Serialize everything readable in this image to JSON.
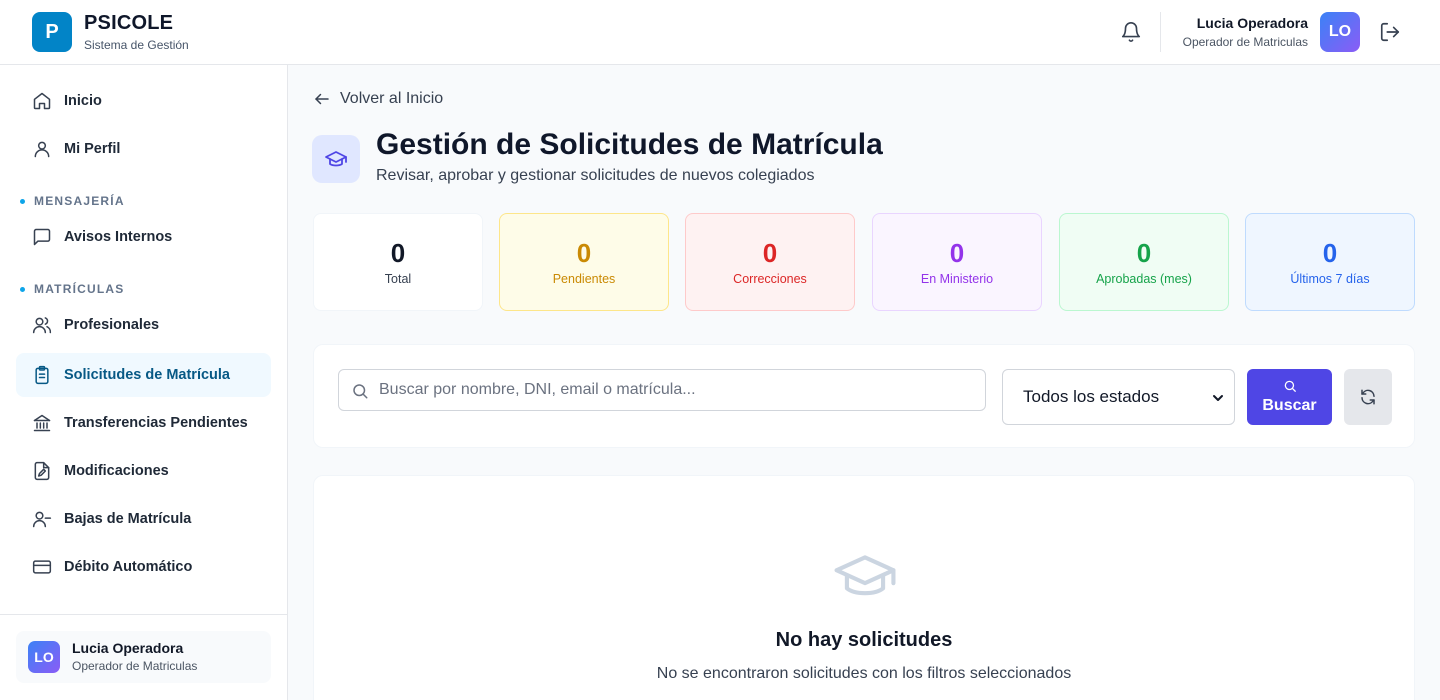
{
  "header": {
    "logo_letter": "P",
    "brand": "PSICOLE",
    "brand_sub": "Sistema de Gestión",
    "user_name": "Lucia Operadora",
    "user_role": "Operador de Matriculas",
    "avatar_initials": "LO"
  },
  "sidebar": {
    "items": [
      {
        "label": "Inicio",
        "icon": "home-icon"
      },
      {
        "label": "Mi Perfil",
        "icon": "user-icon"
      },
      {
        "label": "Avisos Internos",
        "icon": "message-icon"
      },
      {
        "label": "Profesionales",
        "icon": "users-icon"
      },
      {
        "label": "Solicitudes de Matrícula",
        "icon": "clipboard-icon",
        "active": true
      },
      {
        "label": "Transferencias Pendientes",
        "icon": "bank-icon"
      },
      {
        "label": "Modificaciones",
        "icon": "file-edit-icon"
      },
      {
        "label": "Bajas de Matrícula",
        "icon": "user-minus-icon"
      },
      {
        "label": "Débito Automático",
        "icon": "credit-card-icon"
      }
    ],
    "sections": [
      "MENSAJERÍA",
      "MATRÍCULAS"
    ],
    "footer": {
      "initials": "LO",
      "name": "Lucia Operadora",
      "role": "Operador de Matriculas"
    }
  },
  "main": {
    "back_label": "Volver al Inicio",
    "title": "Gestión de Solicitudes de Matrícula",
    "subtitle": "Revisar, aprobar y gestionar solicitudes de nuevos colegiados",
    "stats": [
      {
        "value": "0",
        "label": "Total",
        "color": "#111827",
        "bg": "#ffffff",
        "border": "#f1f5f9"
      },
      {
        "value": "0",
        "label": "Pendientes",
        "color": "#ca8a04",
        "bg": "#fefce8",
        "border": "#fde68a"
      },
      {
        "value": "0",
        "label": "Correcciones",
        "color": "#dc2626",
        "bg": "#fef2f2",
        "border": "#fecaca"
      },
      {
        "value": "0",
        "label": "En Ministerio",
        "color": "#9333ea",
        "bg": "#faf5ff",
        "border": "#e9d5ff"
      },
      {
        "value": "0",
        "label": "Aprobadas (mes)",
        "color": "#16a34a",
        "bg": "#f0fdf4",
        "border": "#bbf7d0"
      },
      {
        "value": "0",
        "label": "Últimos 7 días",
        "color": "#2563eb",
        "bg": "#eff6ff",
        "border": "#bfdbfe"
      }
    ],
    "search_placeholder": "Buscar por nombre, DNI, email o matrícula...",
    "status_select": "Todos los estados",
    "search_button": "Buscar",
    "empty_title": "No hay solicitudes",
    "empty_sub": "No se encontraron solicitudes con los filtros seleccionados"
  },
  "colors": {
    "accent": "#4f46e5",
    "brand": "#0284c7",
    "active_nav_bg": "#f0f9ff",
    "active_nav_text": "#075985"
  }
}
